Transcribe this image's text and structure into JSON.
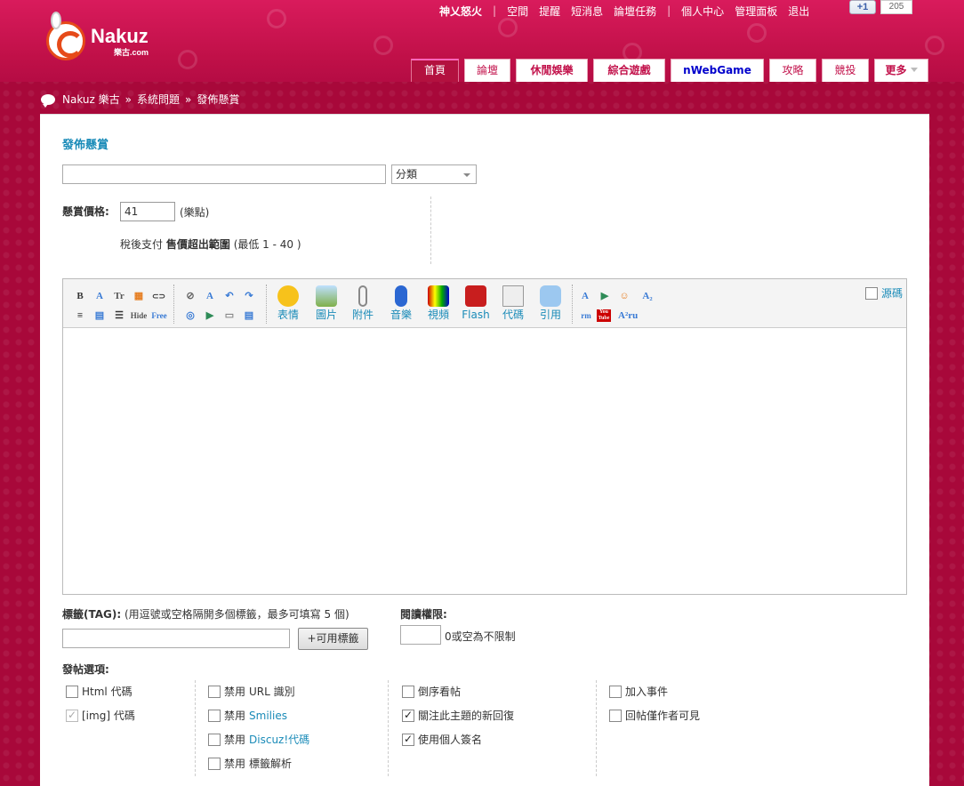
{
  "header": {
    "logo_name": "Nakuz",
    "logo_sub": "樂古.com",
    "username": "神乂怒火",
    "top_links_a": [
      "空間",
      "提醒",
      "短消息",
      "論壇任務"
    ],
    "top_links_b": [
      "個人中心",
      "管理面板",
      "退出"
    ],
    "plusone_label": "+1",
    "plusone_count": "205"
  },
  "nav": {
    "tabs": [
      "首頁",
      "論壇",
      "休閒娛樂",
      "綜合遊戲",
      "nWebGame",
      "攻略",
      "競投",
      "更多"
    ]
  },
  "breadcrumb": [
    "Nakuz 樂古",
    "系統問題",
    "發佈懸賞"
  ],
  "breadcrumb_sep": "»",
  "form": {
    "title": "發佈懸賞",
    "subject_value": "",
    "category_value": "分類",
    "bounty_label": "懸賞價格:",
    "bounty_value": "41",
    "bounty_unit": "(樂點)",
    "note_prefix": "稅後支付",
    "note_bold": "售價超出範圍",
    "note_suffix": "(最低 1 - 40 )"
  },
  "editor": {
    "buttons": [
      "表情",
      "圖片",
      "附件",
      "音樂",
      "視頻",
      "Flash",
      "代碼",
      "引用"
    ],
    "source_label": "源碼",
    "small_icons_row1": [
      "B",
      "A",
      "Tr",
      "▦",
      "⊂⊃",
      "⊘",
      "A",
      "↶",
      "↷"
    ],
    "small_icons_row2": [
      "≡",
      "▤",
      "☰",
      "Hide",
      "Free",
      "◎",
      "▶",
      "▭",
      "▤"
    ],
    "extra_row1": [
      "A",
      "▶",
      "☺",
      "A₂"
    ],
    "extra_row2": [
      "rm",
      "You Tube",
      "A²ru"
    ]
  },
  "tags": {
    "label_bold": "標籤(TAG):",
    "label_rest": "(用逗號或空格隔開多個標籤，最多可填寫 5 個)",
    "button": "+可用標籤"
  },
  "permission": {
    "label": "閱讀權限:",
    "hint": "0或空為不限制"
  },
  "options": {
    "label": "發帖選項:",
    "col1": [
      {
        "label": "Html 代碼",
        "checked": false,
        "disabled": false
      },
      {
        "label": "[img] 代碼",
        "checked": true,
        "disabled": true
      }
    ],
    "col2": [
      {
        "prefix": "禁用",
        "label": "URL 識別",
        "blue": false
      },
      {
        "prefix": "禁用",
        "label": "Smilies",
        "blue": true
      },
      {
        "prefix": "禁用",
        "label": "Discuz!代碼",
        "blue": true
      },
      {
        "prefix": "禁用",
        "label": "標籤解析",
        "blue": false
      }
    ],
    "col3": [
      {
        "label": "倒序看帖",
        "checked": false
      },
      {
        "label": "關注此主題的新回復",
        "checked": true
      },
      {
        "label": "使用個人簽名",
        "checked": true
      }
    ],
    "col4": [
      {
        "label": "加入事件",
        "checked": false
      },
      {
        "label": "回帖僅作者可見",
        "checked": false
      }
    ]
  }
}
